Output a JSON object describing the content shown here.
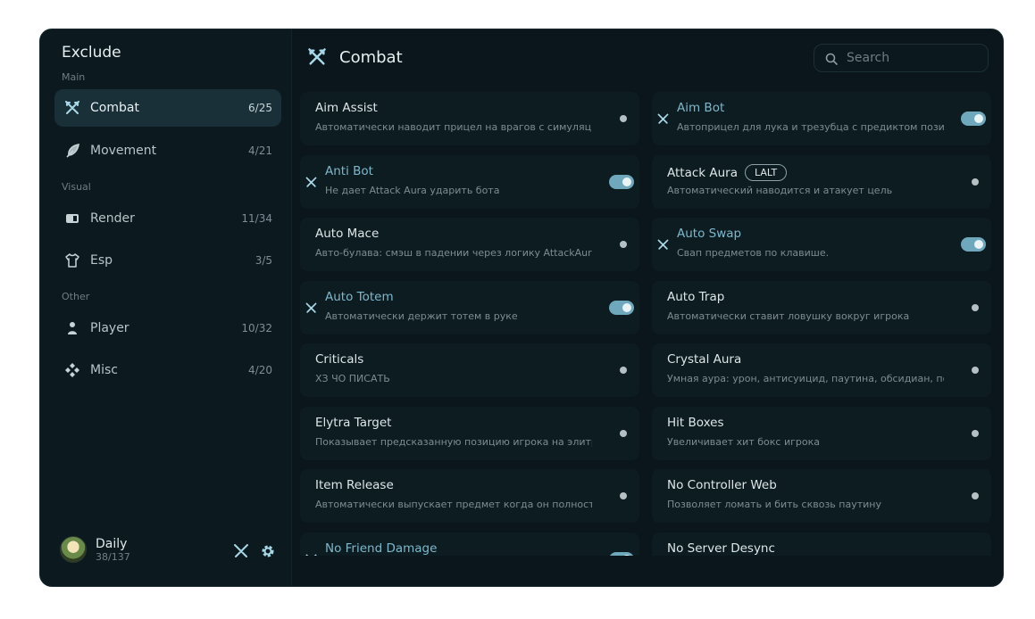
{
  "sidebar": {
    "brand": "Exclude",
    "sections": {
      "main": "Main",
      "visual": "Visual",
      "other": "Other"
    },
    "items": [
      {
        "label": "Combat",
        "count": "6/25",
        "icon": "swords-icon",
        "active": true
      },
      {
        "label": "Movement",
        "count": "4/21",
        "icon": "feather-icon"
      },
      {
        "label": "Render",
        "count": "11/34",
        "icon": "render-icon"
      },
      {
        "label": "Esp",
        "count": "3/5",
        "icon": "shirt-icon"
      },
      {
        "label": "Player",
        "count": "10/32",
        "icon": "person-icon"
      },
      {
        "label": "Misc",
        "count": "4/20",
        "icon": "diamonds-icon"
      }
    ],
    "profile": {
      "name": "Daily",
      "sub": "38/137"
    }
  },
  "header": {
    "title": "Combat",
    "search_placeholder": "Search"
  },
  "modules": [
    {
      "name": "Aim Assist",
      "desc": "Автоматически наводит прицел на врагов с симуляцией",
      "enabled": false
    },
    {
      "name": "Aim Bot",
      "desc": "Автоприцел для лука и трезубца с предиктом позиции",
      "enabled": true
    },
    {
      "name": "Anti Bot",
      "desc": "Не дает Attack Aura ударить бота",
      "enabled": true
    },
    {
      "name": "Attack Aura",
      "desc": "Автоматический наводится и атакует цель",
      "enabled": false,
      "key": "LALT"
    },
    {
      "name": "Auto Mace",
      "desc": "Авто-булава: смэш в падении через логику AttackAura",
      "enabled": false
    },
    {
      "name": "Auto Swap",
      "desc": "Свап предметов по клавише.",
      "enabled": true
    },
    {
      "name": "Auto Totem",
      "desc": "Автоматически держит тотем в руке",
      "enabled": true
    },
    {
      "name": "Auto Trap",
      "desc": "Автоматически ставит ловушку вокруг игрока",
      "enabled": false
    },
    {
      "name": "Criticals",
      "desc": "ХЗ ЧО ПИСАТЬ",
      "enabled": false
    },
    {
      "name": "Crystal Aura",
      "desc": "Умная аура: урон, антисуицид, паутина, обсидиан, подсв",
      "enabled": false
    },
    {
      "name": "Elytra Target",
      "desc": "Показывает предсказанную позицию игрока на элитрах",
      "enabled": false
    },
    {
      "name": "Hit Boxes",
      "desc": "Увеличивает хит бокс игрока",
      "enabled": false
    },
    {
      "name": "Item Release",
      "desc": "Автоматически выпускает предмет когда он полностью и",
      "enabled": false
    },
    {
      "name": "No Controller Web",
      "desc": "Позволяет ломать и бить сквозь паутину",
      "enabled": false
    },
    {
      "name": "No Friend Damage",
      "desc": "",
      "enabled": true
    },
    {
      "name": "No Server Desync",
      "desc": "",
      "enabled": false
    }
  ],
  "colors": {
    "accent": "#6fa8bd",
    "background": "#0a161b",
    "sidebar": "#0c1a1f"
  }
}
